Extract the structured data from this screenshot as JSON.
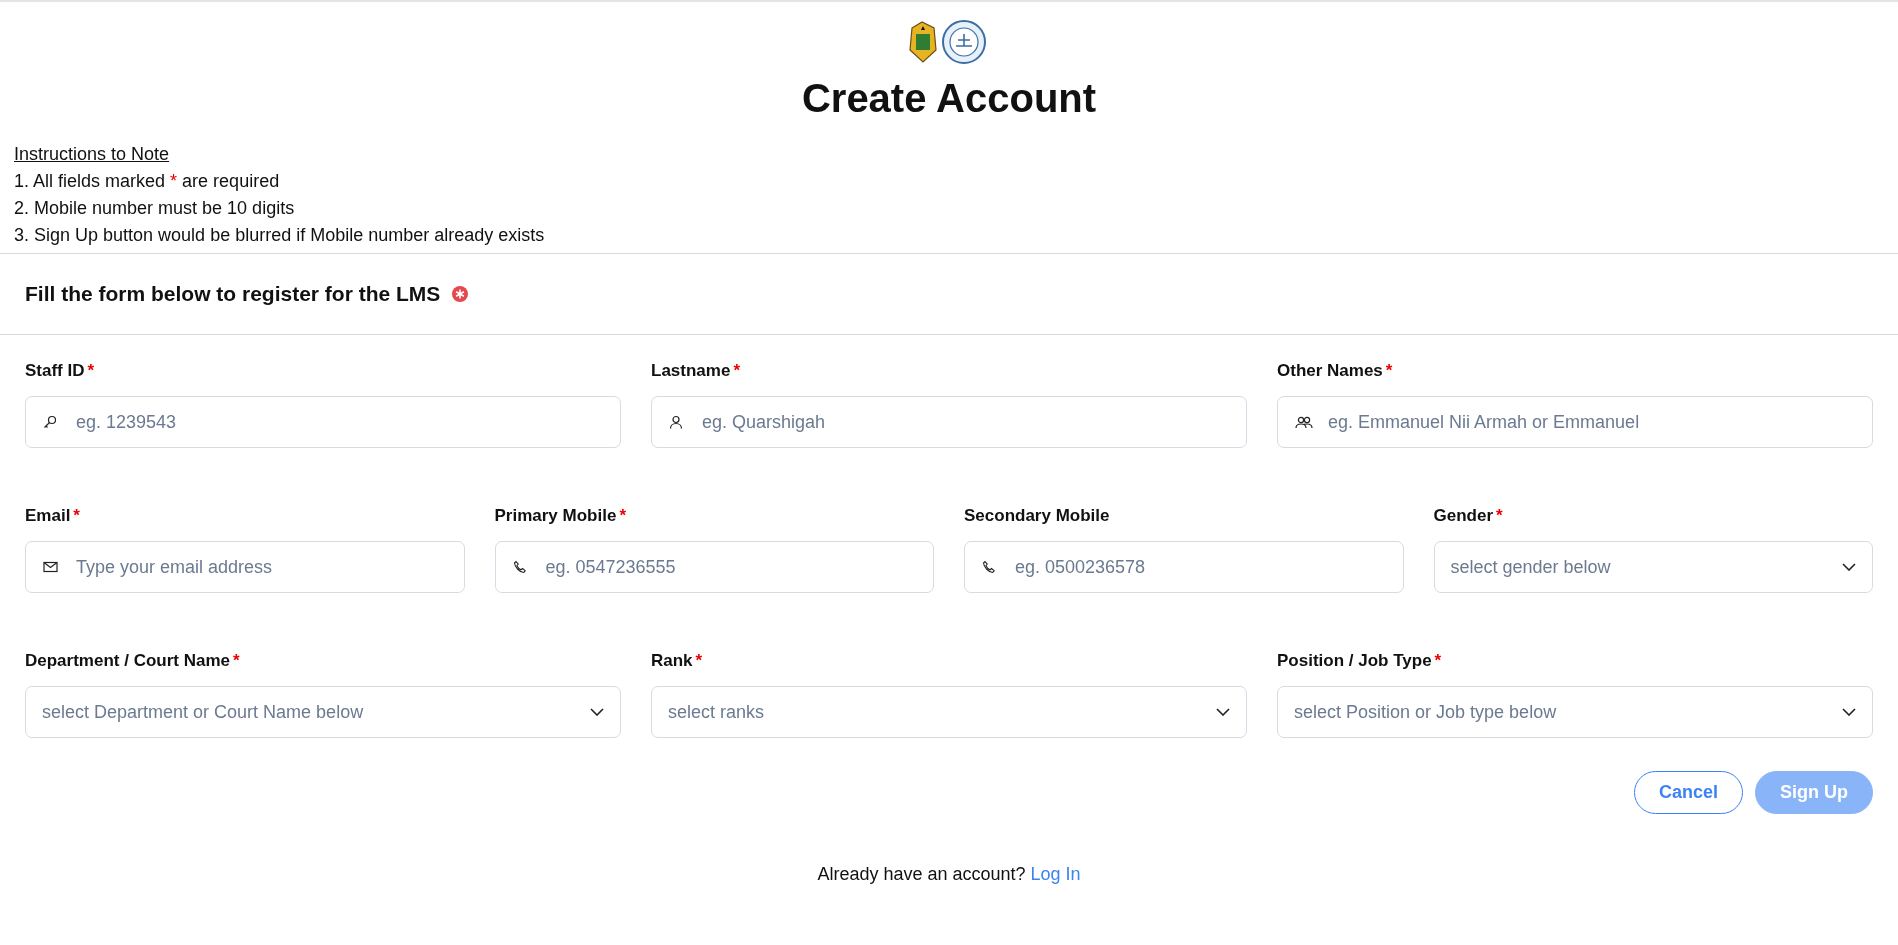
{
  "title": "Create Account",
  "instructions": {
    "heading": "Instructions to Note",
    "items": [
      "1. All fields marked * are required",
      "2. Mobile number must be 10 digits",
      "3. Sign Up button would be blurred if Mobile number already exists"
    ]
  },
  "form": {
    "heading": "Fill the form below to register for the LMS",
    "rows": [
      [
        {
          "label": "Staff ID",
          "mark": "*",
          "kind": "id",
          "placeholder": "eg. 1239543"
        },
        {
          "label": "Lastname",
          "mark": "*",
          "kind": "person",
          "placeholder": "eg. Quarshigah"
        },
        {
          "label": "Other Names",
          "mark": "*",
          "kind": "people",
          "placeholder": "eg. Emmanuel Nii Armah or Emmanuel"
        }
      ],
      [
        {
          "label": "Email",
          "mark": "*",
          "kind": "email",
          "placeholder": "Type your email address"
        },
        {
          "label": "Primary Mobile",
          "mark": "*",
          "kind": "phone",
          "placeholder": "eg. 0547236555"
        },
        {
          "label": "Secondary Mobile",
          "kind": "phone",
          "placeholder": "eg. 0500236578"
        },
        {
          "label": "Gender",
          "mark": "*",
          "kind": "select",
          "placeholder": "select gender below"
        }
      ],
      [
        {
          "label": "Department / Court Name",
          "mark": "*",
          "kind": "select",
          "placeholder": "select Department or Court Name below"
        },
        {
          "label": "Rank",
          "mark": "*",
          "kind": "select",
          "placeholder": "select ranks"
        },
        {
          "label": "Position / Job Type",
          "mark": "*",
          "kind": "select",
          "placeholder": "select Position or Job type below"
        }
      ]
    ],
    "buttons": [
      {
        "label": "Cancel",
        "kind": "outline",
        "disabled": false
      },
      {
        "label": "Sign Up",
        "kind": "primary",
        "disabled": true
      }
    ]
  },
  "footer": {
    "text": "Already have an account?",
    "link": "Log In"
  }
}
